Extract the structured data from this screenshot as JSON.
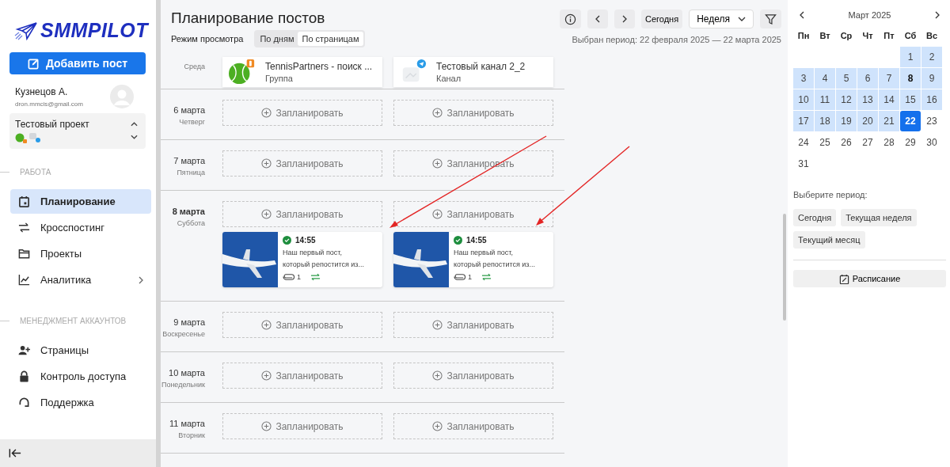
{
  "sidebar": {
    "logo": "SMMPILOT",
    "add_button": "Добавить пост",
    "user": {
      "name": "Кузнецов А.",
      "email": "dron.mmcis@gmail.com"
    },
    "project": {
      "name": "Тестовый проект"
    },
    "sections": [
      {
        "title": "РАБОТА",
        "items": [
          {
            "label": "Планирование",
            "selected": true,
            "has_submenu": false
          },
          {
            "label": "Кросспостинг",
            "selected": false,
            "has_submenu": false
          },
          {
            "label": "Проекты",
            "selected": false,
            "has_submenu": false
          },
          {
            "label": "Аналитика",
            "selected": false,
            "has_submenu": true
          }
        ]
      },
      {
        "title": "МЕНЕДЖМЕНТ АККАУНТОВ",
        "items": [
          {
            "label": "Страницы",
            "selected": false,
            "has_submenu": false
          },
          {
            "label": "Контроль доступа",
            "selected": false,
            "has_submenu": false
          },
          {
            "label": "Поддержка",
            "selected": false,
            "has_submenu": false
          }
        ]
      }
    ]
  },
  "header": {
    "title": "Планирование постов",
    "view_mode_label": "Режим просмотра",
    "view_modes": [
      {
        "label": "По дням",
        "selected": false
      },
      {
        "label": "По страницам",
        "selected": true
      }
    ],
    "today_button": "Сегодня",
    "range_select": "Неделя",
    "period": "Выбран период: 22 февраля 2025 — 22 марта 2025"
  },
  "schedule": {
    "top_row_weekday": "Среда",
    "pages": [
      {
        "name": "TennisPartners - поиск ...",
        "type": "Группа",
        "kind": "group"
      },
      {
        "name": "Тестовый канал 2_2",
        "type": "Канал",
        "kind": "channel"
      }
    ],
    "days": [
      {
        "date": "6 марта",
        "weekday": "Четверг",
        "highlight": false,
        "slots": [
          {
            "action": "Запланировать"
          },
          {
            "action": "Запланировать"
          }
        ]
      },
      {
        "date": "7 марта",
        "weekday": "Пятница",
        "highlight": false,
        "slots": [
          {
            "action": "Запланировать"
          },
          {
            "action": "Запланировать"
          }
        ]
      },
      {
        "date": "8 марта",
        "weekday": "Суббота",
        "highlight": true,
        "slots": [
          {
            "action": "Запланировать",
            "posts": [
              {
                "time": "14:55",
                "published": true,
                "text": "Наш первый пост, который репостится из...",
                "attachments": "1",
                "crossposted": true
              }
            ]
          },
          {
            "action": "Запланировать",
            "posts": [
              {
                "time": "14:55",
                "published": true,
                "text": "Наш первый пост, который репостится из...",
                "attachments": "1",
                "crossposted": true
              }
            ]
          }
        ]
      },
      {
        "date": "9 марта",
        "weekday": "Воскресенье",
        "highlight": false,
        "slots": [
          {
            "action": "Запланировать"
          },
          {
            "action": "Запланировать"
          }
        ]
      },
      {
        "date": "10 марта",
        "weekday": "Понедельник",
        "highlight": false,
        "slots": [
          {
            "action": "Запланировать"
          },
          {
            "action": "Запланировать"
          }
        ]
      },
      {
        "date": "11 марта",
        "weekday": "Вторник",
        "highlight": false,
        "slots": [
          {
            "action": "Запланировать"
          },
          {
            "action": "Запланировать"
          }
        ]
      }
    ]
  },
  "calendar": {
    "title": "Март 2025",
    "weekdays": [
      "Пн",
      "Вт",
      "Ср",
      "Чт",
      "Пт",
      "Сб",
      "Вс"
    ],
    "weeks": [
      [
        {
          "day": "1",
          "in_range": true,
          "selected": false,
          "bold": false
        },
        {
          "day": "2",
          "in_range": true,
          "selected": false,
          "bold": false
        }
      ],
      [
        {
          "day": "3",
          "in_range": true,
          "selected": false,
          "bold": false
        },
        {
          "day": "4",
          "in_range": true,
          "selected": false,
          "bold": false
        },
        {
          "day": "5",
          "in_range": true,
          "selected": false,
          "bold": false
        },
        {
          "day": "6",
          "in_range": true,
          "selected": false,
          "bold": false
        },
        {
          "day": "7",
          "in_range": true,
          "selected": false,
          "bold": false
        },
        {
          "day": "8",
          "in_range": true,
          "selected": false,
          "bold": true
        },
        {
          "day": "9",
          "in_range": true,
          "selected": false,
          "bold": false
        }
      ],
      [
        {
          "day": "10",
          "in_range": true,
          "selected": false,
          "bold": false
        },
        {
          "day": "11",
          "in_range": true,
          "selected": false,
          "bold": false
        },
        {
          "day": "12",
          "in_range": true,
          "selected": false,
          "bold": false
        },
        {
          "day": "13",
          "in_range": true,
          "selected": false,
          "bold": false
        },
        {
          "day": "14",
          "in_range": true,
          "selected": false,
          "bold": false
        },
        {
          "day": "15",
          "in_range": true,
          "selected": false,
          "bold": false
        },
        {
          "day": "16",
          "in_range": true,
          "selected": false,
          "bold": false
        }
      ],
      [
        {
          "day": "17",
          "in_range": true,
          "selected": false,
          "bold": false
        },
        {
          "day": "18",
          "in_range": true,
          "selected": false,
          "bold": false
        },
        {
          "day": "19",
          "in_range": true,
          "selected": false,
          "bold": false
        },
        {
          "day": "20",
          "in_range": true,
          "selected": false,
          "bold": false
        },
        {
          "day": "21",
          "in_range": true,
          "selected": false,
          "bold": false
        },
        {
          "day": "22",
          "in_range": true,
          "selected": true,
          "bold": false
        },
        {
          "day": "23",
          "in_range": false,
          "selected": false,
          "bold": false
        }
      ],
      [
        {
          "day": "24",
          "in_range": false,
          "selected": false,
          "bold": false
        },
        {
          "day": "25",
          "in_range": false,
          "selected": false,
          "bold": false
        },
        {
          "day": "26",
          "in_range": false,
          "selected": false,
          "bold": false
        },
        {
          "day": "27",
          "in_range": false,
          "selected": false,
          "bold": false
        },
        {
          "day": "28",
          "in_range": false,
          "selected": false,
          "bold": false
        },
        {
          "day": "29",
          "in_range": false,
          "selected": false,
          "bold": false
        },
        {
          "day": "30",
          "in_range": false,
          "selected": false,
          "bold": false
        }
      ],
      [
        {
          "day": "31",
          "in_range": false,
          "selected": false,
          "bold": false
        }
      ]
    ],
    "period_label": "Выберите период:",
    "period_buttons": [
      "Сегодня",
      "Текущая неделя",
      "Текущий месяц"
    ],
    "schedule_button": "Расписание"
  }
}
